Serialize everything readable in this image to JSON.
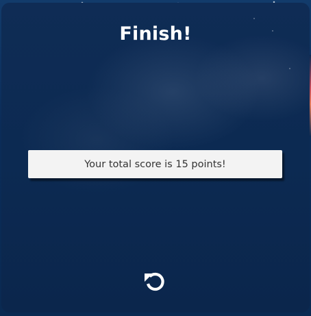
{
  "game": {
    "title": "Finish!",
    "score_message": "Your total score is 15 points!",
    "score": 15,
    "replay_icon": "replay-icon"
  },
  "colors": {
    "panel_background": "#0c2a52",
    "title_text": "#ffffff",
    "score_box_background": "#f3f3f3",
    "score_text": "#333333",
    "replay_icon": "#ffffff"
  }
}
